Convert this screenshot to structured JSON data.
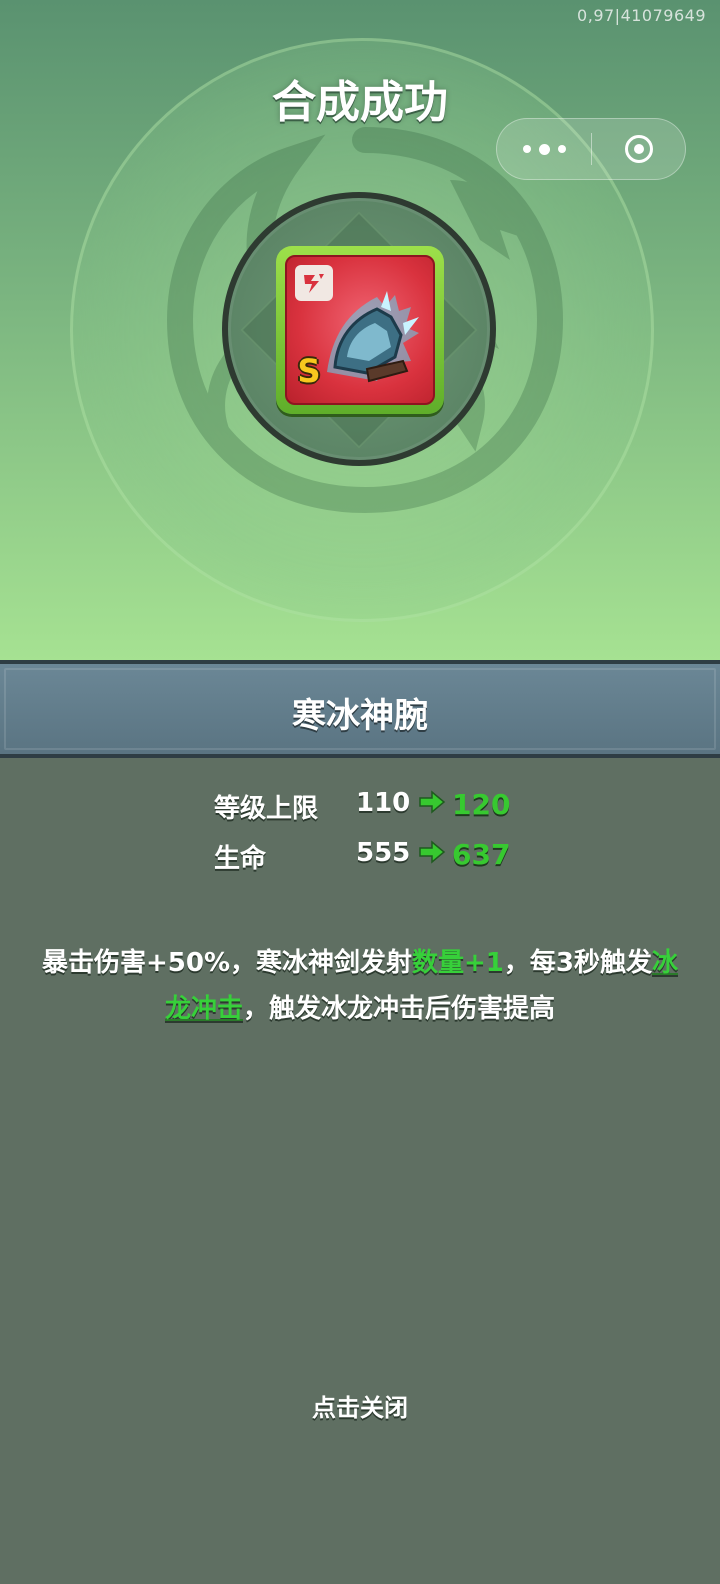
{
  "status_bar": {
    "version_text": "0,97|41079649"
  },
  "header": {
    "title": "合成成功"
  },
  "capsule": {
    "more_icon": "more-dots-icon",
    "close_icon": "target-close-icon"
  },
  "item": {
    "name": "寒冰神腕",
    "rarity": "S",
    "type_icon": "weapon-type-icon",
    "image_icon": "ice-gauntlet-icon"
  },
  "stats": [
    {
      "label": "等级上限",
      "old": "110",
      "new": "120"
    },
    {
      "label": "生命",
      "old": "555",
      "new": "637"
    }
  ],
  "description": {
    "p1": "暴击伤害+50%，寒冰神剑发射",
    "hl1": "数量+1",
    "p2": "，每3秒触发",
    "link": "冰龙冲击",
    "p3": "，触发冰龙冲击后伤害提高"
  },
  "footer": {
    "close_hint": "点击关闭"
  },
  "colors": {
    "accent_green": "#37c930",
    "card_red": "#d9323e",
    "card_border": "#7cc23a",
    "bar_blue": "#5f7a88"
  }
}
